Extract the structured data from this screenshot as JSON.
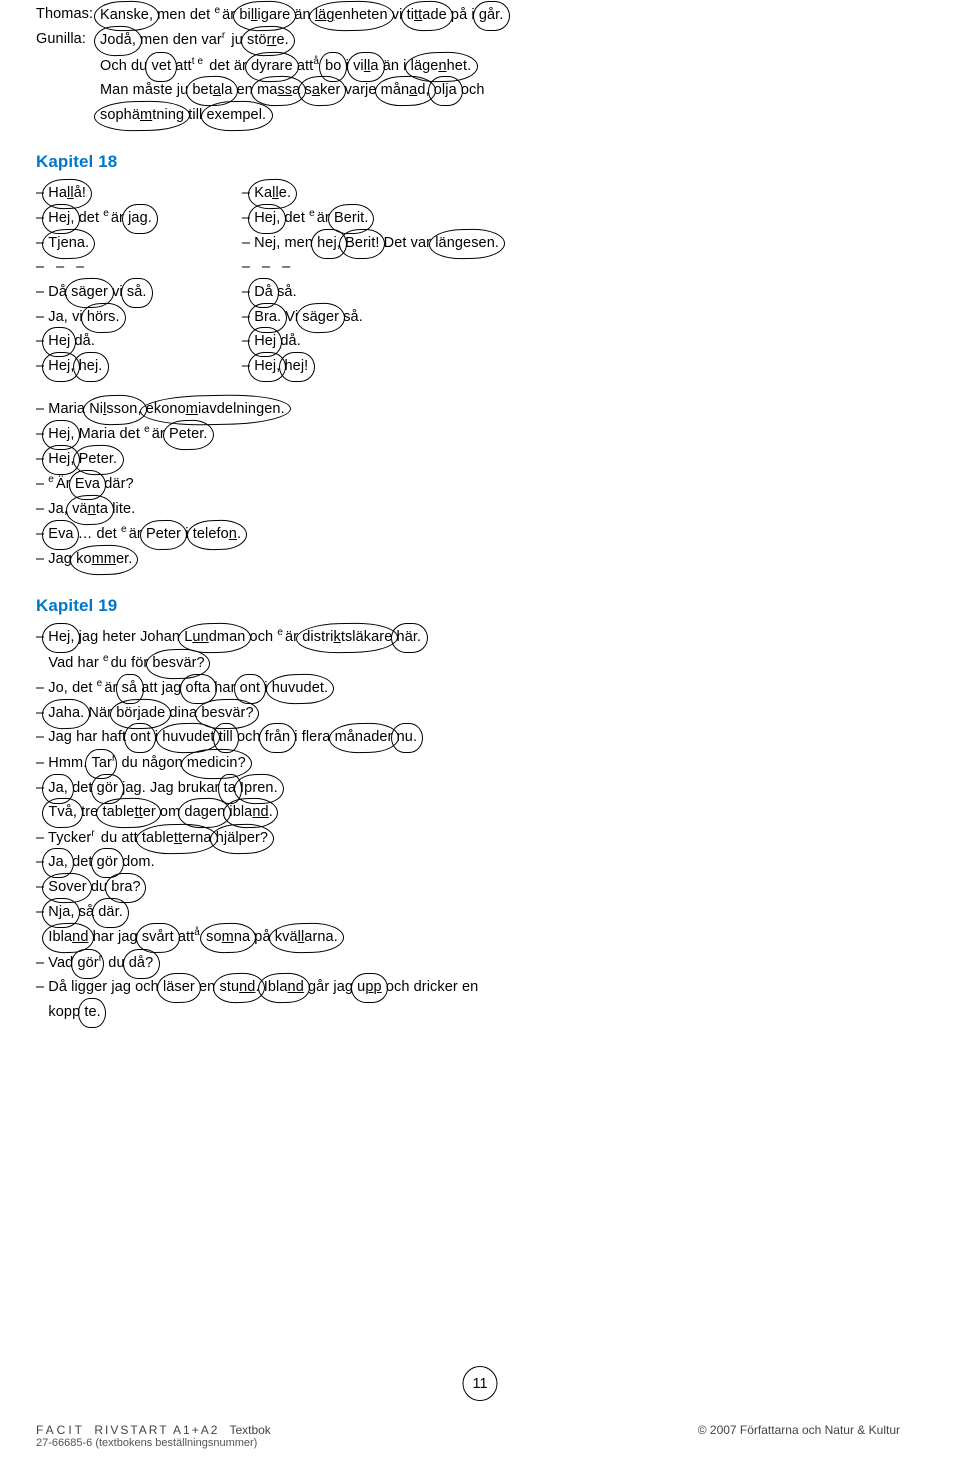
{
  "dialog_top": {
    "rows": [
      {
        "speaker": "Thomas:",
        "text": "Kanske, men det är billigare än lägenheten vi tittade på i går."
      },
      {
        "speaker": "Gunilla:",
        "text": "Jodå, men den var ju större."
      }
    ],
    "cont": [
      "Och du vet att det är dyrare att bo i villa än i lägenhet.",
      "Man måste ju betala en massa saker varje månad, olja och",
      "sophämtning till exempel."
    ]
  },
  "ch18": {
    "heading": "Kapitel 18",
    "left": [
      "– Hallå!",
      "– Hej, det är jag.",
      "– Tjena.",
      "– – –",
      "– Då säger vi så.",
      "– Ja, vi hörs.",
      "– Hej då.",
      "– Hej, hej."
    ],
    "right": [
      "– Kalle.",
      "– Hej, det är Berit.",
      "– Nej, men hej, Berit! Det var längesen.",
      "– – –",
      "– Då så.",
      "– Bra. Vi säger så.",
      "– Hej då.",
      "– Hej, hej!"
    ],
    "block2": [
      "– Maria Nilsson, ekonomiavdelningen.",
      "– Hej, Maria det är Peter.",
      "– Hej, Peter.",
      "– Är Eva där?",
      "– Ja, vänta lite.",
      "– Eva … det är Peter i telefon.",
      "– Jag kommer."
    ]
  },
  "ch19": {
    "heading": "Kapitel 19",
    "lines": [
      "– Hej, jag heter Johan Lundman och är distriktsläkare här.",
      "   Vad har du för besvär?",
      "– Jo, det är så att jag ofta har ont i huvudet.",
      "– Jaha. När började dina besvär?",
      "– Jag har haft ont i huvudet till och från i flera månader nu.",
      "– Hmm. Tar du någon medicin?",
      "– Ja, det gör jag. Jag brukar ta Ipren.",
      "   Två, tre tabletter om dagen ibland.",
      "– Tycker du att tabletterna hjälper?",
      "– Ja, det gör dom.",
      "– Sover du bra?",
      "– Nja, så där.",
      "   Ibland har jag svårt att somna på kvällarna.",
      "– Vad gör du då?",
      "– Då ligger jag och läser en stund. Ibland går jag upp och dricker en",
      "   kopp te."
    ]
  },
  "page_number": "11",
  "footer": {
    "facit": "FACIT",
    "book": "RIVSTART A1+A2",
    "suffix": "Textbok",
    "isbn": "27-66685-6 (textbokens beställningsnummer)",
    "copyright": "© 2007 Författarna och Natur & Kultur"
  }
}
